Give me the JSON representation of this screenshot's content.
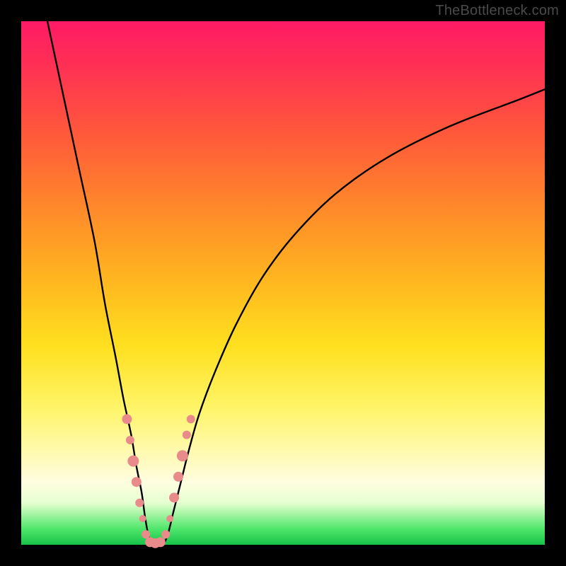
{
  "watermark": "TheBottleneck.com",
  "chart_data": {
    "type": "line",
    "title": "",
    "xlabel": "",
    "ylabel": "",
    "xlim": [
      0,
      100
    ],
    "ylim": [
      0,
      100
    ],
    "series": [
      {
        "name": "bottleneck-curve",
        "x": [
          5,
          8,
          11,
          14,
          16,
          18,
          19.5,
          21,
          22,
          23,
          23.7,
          24.5,
          25.5,
          27,
          28,
          29,
          30.5,
          32,
          34,
          37,
          41,
          46,
          52,
          60,
          70,
          82,
          95,
          100
        ],
        "y": [
          100,
          86,
          72,
          58,
          46,
          36,
          28,
          21,
          15,
          10,
          5,
          1,
          0,
          0,
          2,
          6,
          12,
          18,
          25,
          33,
          42,
          51,
          59,
          67,
          74,
          80,
          85,
          87
        ]
      }
    ],
    "markers": {
      "name": "highlight-dots",
      "color": "#e98b8b",
      "points": [
        {
          "x": 20.2,
          "y": 24,
          "r": 7
        },
        {
          "x": 20.8,
          "y": 20,
          "r": 6
        },
        {
          "x": 21.4,
          "y": 16,
          "r": 8
        },
        {
          "x": 22.0,
          "y": 12,
          "r": 7
        },
        {
          "x": 22.6,
          "y": 8,
          "r": 6
        },
        {
          "x": 23.2,
          "y": 5,
          "r": 5
        },
        {
          "x": 23.8,
          "y": 2,
          "r": 6
        },
        {
          "x": 24.6,
          "y": 0.5,
          "r": 7
        },
        {
          "x": 25.6,
          "y": 0.3,
          "r": 7
        },
        {
          "x": 26.6,
          "y": 0.5,
          "r": 7
        },
        {
          "x": 27.6,
          "y": 2,
          "r": 6
        },
        {
          "x": 28.4,
          "y": 5,
          "r": 5
        },
        {
          "x": 29.2,
          "y": 9,
          "r": 7
        },
        {
          "x": 30.0,
          "y": 13,
          "r": 7
        },
        {
          "x": 30.8,
          "y": 17,
          "r": 8
        },
        {
          "x": 31.6,
          "y": 21,
          "r": 6
        },
        {
          "x": 32.4,
          "y": 24,
          "r": 6
        }
      ]
    }
  }
}
